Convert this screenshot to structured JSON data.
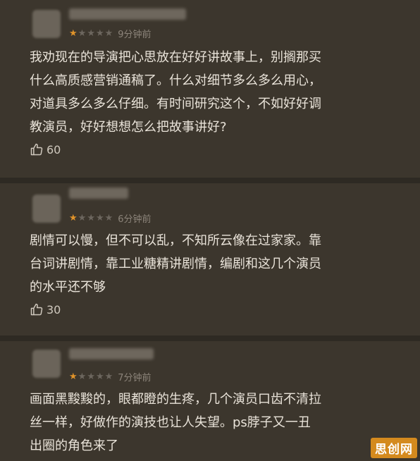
{
  "reviews": [
    {
      "rating": 1,
      "rating_max": 5,
      "time": "9分钟前",
      "text": "我劝现在的导演把心思放在好好讲故事上，别搁那买\n什么高质感营销通稿了。什么对细节多么多么用心，\n对道具多么多么仔细。有时间研究这个，不如好好调\n教演员，好好想想怎么把故事讲好?",
      "likes": "60"
    },
    {
      "rating": 1,
      "rating_max": 5,
      "time": "6分钟前",
      "text": "剧情可以慢，但不可以乱，不知所云像在过家家。靠\n台词讲剧情，靠工业糖精讲剧情，编剧和这几个演员\n的水平还不够",
      "likes": "30"
    },
    {
      "rating": 1,
      "rating_max": 5,
      "time": "7分钟前",
      "text": "画面黑黢黢的，眼都瞪的生疼，几个演员口齿不清拉\n丝一样，好做作的演技也让人失望。ps脖子又一丑\n出圈的角色来了",
      "likes": ""
    }
  ],
  "icons": {
    "star": "star-icon",
    "like": "thumbs-up-icon"
  },
  "colors": {
    "background": "#3c362d",
    "star_on": "#e0932a",
    "star_off": "#6c665e"
  },
  "watermark": "思创网"
}
